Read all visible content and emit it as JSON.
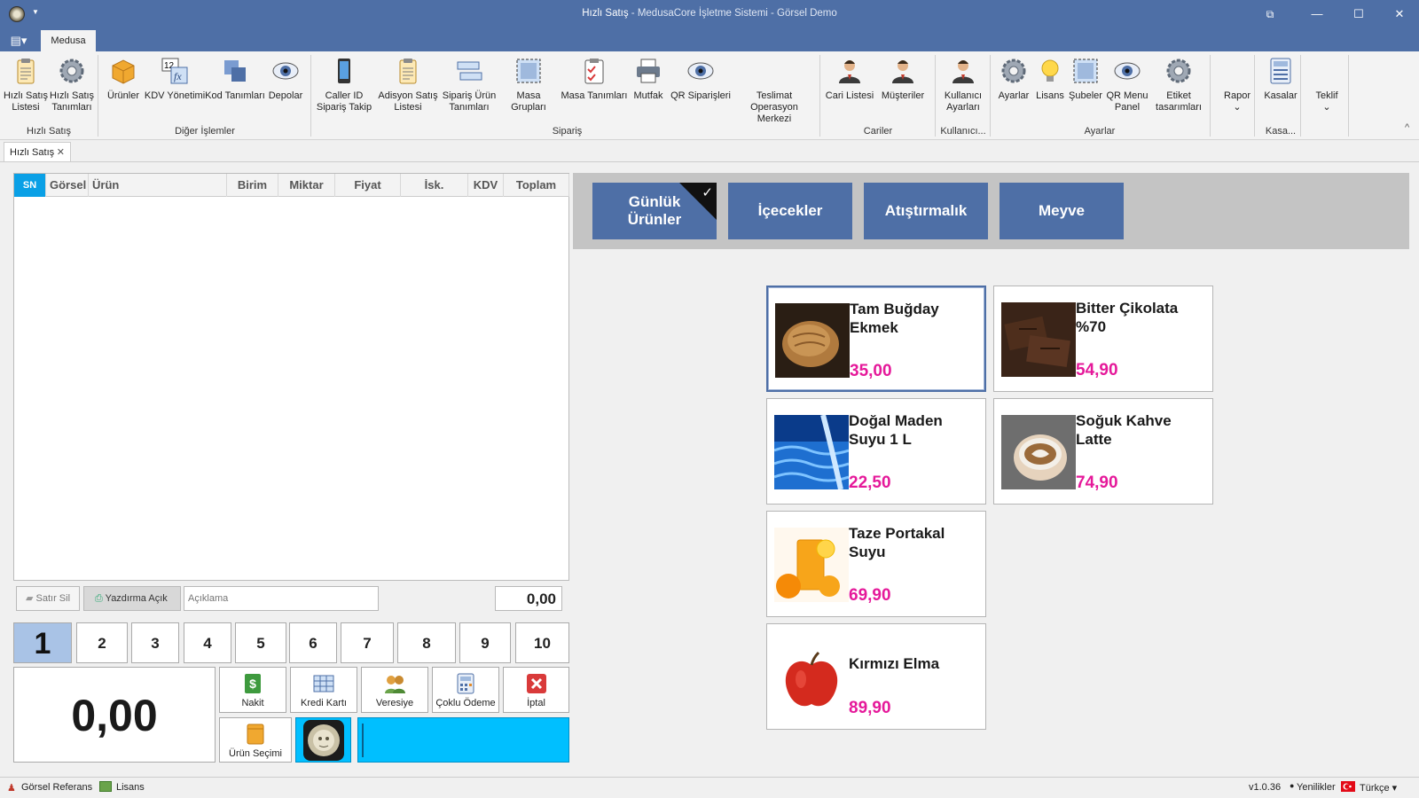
{
  "window": {
    "title_main": "Hızlı Satış",
    "title_rest": " - MedusaCore İşletme Sistemi - Görsel Demo",
    "minimize": "—",
    "maximize": "☐",
    "close": "✕",
    "restore_icon": "⧉"
  },
  "ribbon": {
    "tab": "Medusa",
    "groups": [
      {
        "caption": "Hızlı Satış",
        "buttons": [
          {
            "label": "Hızlı Satış\nListesi",
            "icon": "clipboard-icon"
          },
          {
            "label": "Hızlı Satış\nTanımları",
            "icon": "gear-icon"
          }
        ]
      },
      {
        "caption": "Diğer İşlemler",
        "buttons": [
          {
            "label": "Ürünler",
            "icon": "box-icon"
          },
          {
            "label": "KDV Yönetimi",
            "icon": "formula-icon"
          },
          {
            "label": "Kod Tanımları",
            "icon": "squares-icon"
          },
          {
            "label": "Depolar",
            "icon": "eye-icon"
          }
        ]
      },
      {
        "caption": "Sipariş",
        "buttons": [
          {
            "label": "Caller ID\nSipariş Takip",
            "icon": "phone-icon"
          },
          {
            "label": "Adisyon Satış\nListesi",
            "icon": "clipboard-icon"
          },
          {
            "label": "Sipariş Ürün\nTanımları",
            "icon": "list-icon"
          },
          {
            "label": "Masa Grupları",
            "icon": "select-icon"
          },
          {
            "label": "Masa Tanımları",
            "icon": "checklist-icon"
          },
          {
            "label": "Mutfak",
            "icon": "printer-icon"
          },
          {
            "label": "QR Siparişleri",
            "icon": "eye-icon"
          },
          {
            "label": "Teslimat\nOperasyon Merkezi",
            "icon": "none"
          }
        ]
      },
      {
        "caption": "Cariler",
        "buttons": [
          {
            "label": "Cari Listesi",
            "icon": "user-icon"
          },
          {
            "label": "Müşteriler",
            "icon": "user-icon"
          }
        ]
      },
      {
        "caption": "Kullanıcı...",
        "buttons": [
          {
            "label": "Kullanıcı\nAyarları",
            "icon": "user-icon"
          }
        ]
      },
      {
        "caption": "Ayarlar",
        "buttons": [
          {
            "label": "Ayarlar",
            "icon": "gear-icon"
          },
          {
            "label": "Lisans",
            "icon": "bulb-icon"
          },
          {
            "label": "Şubeler",
            "icon": "select-icon"
          },
          {
            "label": "QR Menu\nPanel",
            "icon": "eye-icon"
          },
          {
            "label": "Etiket\ntasarımları",
            "icon": "gear-icon"
          }
        ]
      },
      {
        "caption": "",
        "buttons": [
          {
            "label": "Rapor",
            "icon": "none"
          }
        ]
      },
      {
        "caption": "Kasa...",
        "buttons": [
          {
            "label": "Kasalar",
            "icon": "calculator-icon"
          }
        ]
      },
      {
        "caption": "",
        "buttons": [
          {
            "label": "Teklif",
            "icon": "none"
          }
        ]
      }
    ],
    "collapse": "^"
  },
  "doc_tab": {
    "label": "Hızlı Satış",
    "close": "✕"
  },
  "grid": {
    "columns": [
      "SN",
      "Görsel",
      "Ürün",
      "Birim",
      "Miktar",
      "Fiyat",
      "İsk.",
      "KDV",
      "Toplam"
    ],
    "rows": []
  },
  "grid_footer": {
    "delete_row": "Satır Sil",
    "print_toggle": "Yazdırma Açık",
    "description_placeholder": "Açıklama",
    "subtotal": "0,00"
  },
  "tables": [
    "1",
    "2",
    "3",
    "4",
    "5",
    "6",
    "7",
    "8",
    "9",
    "10"
  ],
  "selected_table": "1",
  "total": "0,00",
  "payments": {
    "cash": "Nakit",
    "card": "Kredi Kartı",
    "credit": "Veresiye",
    "multi": "Çoklu Ödeme",
    "cancel": "İptal",
    "product_select": "Ürün Seçimi"
  },
  "categories": [
    {
      "label": "Günlük\nÜrünler",
      "selected": true
    },
    {
      "label": "İçecekler",
      "selected": false
    },
    {
      "label": "Atıştırmalık",
      "selected": false
    },
    {
      "label": "Meyve",
      "selected": false
    }
  ],
  "products": [
    {
      "name": "Tam Buğday Ekmek",
      "price": "35,00",
      "image": "bread-image"
    },
    {
      "name": "Bitter Çikolata %70",
      "price": "54,90",
      "image": "chocolate-image"
    },
    {
      "name": "Doğal Maden Suyu 1 L",
      "price": "22,50",
      "image": "water-image"
    },
    {
      "name": "Soğuk Kahve Latte",
      "price": "74,90",
      "image": "coffee-image"
    },
    {
      "name": "Taze Portakal Suyu",
      "price": "69,90",
      "image": "orange-juice-image"
    },
    {
      "name": "Kırmızı Elma",
      "price": "89,90",
      "image": "apple-image"
    }
  ],
  "statusbar": {
    "reference": "Görsel Referans",
    "license": "Lisans",
    "version": "v1.0.36",
    "news": "Yenilikler",
    "language": "Türkçe"
  },
  "colors": {
    "accent": "#4e6fa6",
    "price": "#e5199a",
    "cyan_panel": "#00bfff",
    "selected_table": "#a9c3e6"
  }
}
